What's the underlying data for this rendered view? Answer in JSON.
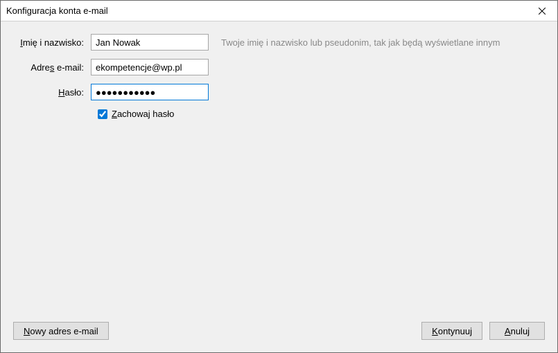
{
  "window": {
    "title": "Konfiguracja konta e-mail"
  },
  "form": {
    "name_label_pre": "I",
    "name_label_rest": "mię i nazwisko:",
    "name_value": "Jan Nowak",
    "name_hint": "Twoje imię i nazwisko lub pseudonim, tak jak będą wyświetlane innym",
    "email_label_pre": "Adre",
    "email_label_u": "s",
    "email_label_rest": " e-mail:",
    "email_value": "ekompetencje@wp.pl",
    "password_label_u": "H",
    "password_label_rest": "asło:",
    "password_value": "●●●●●●●●●●●",
    "remember_u": "Z",
    "remember_rest": "achowaj hasło",
    "remember_checked": true
  },
  "buttons": {
    "new_email_u": "N",
    "new_email_rest": "owy adres e-mail",
    "continue_u": "K",
    "continue_rest": "ontynuuj",
    "cancel_u": "A",
    "cancel_rest": "nuluj"
  }
}
